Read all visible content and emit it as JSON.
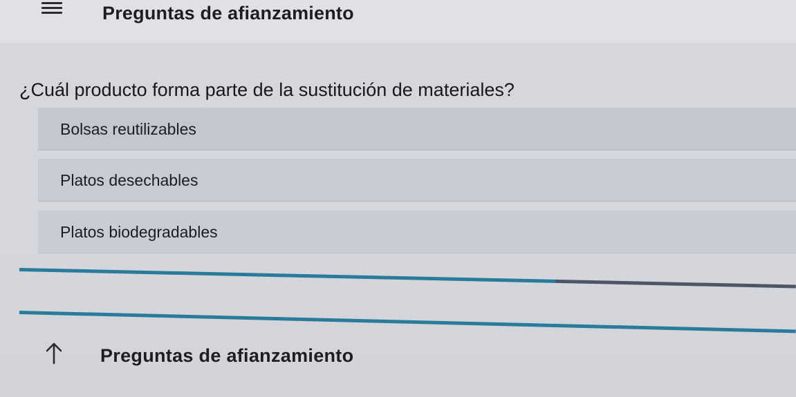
{
  "header": {
    "title": "Preguntas de afianzamiento",
    "menu_icon": "hamburger-menu-icon"
  },
  "question": {
    "text": "¿Cuál producto forma parte de la sustitución de materiales?"
  },
  "options": [
    {
      "label": "Bolsas reutilizables"
    },
    {
      "label": "Platos desechables"
    },
    {
      "label": "Platos biodegradables"
    }
  ],
  "progress": {
    "fraction": 0.69,
    "fill_color": "#2a7a9c",
    "track_color": "#4e5566"
  },
  "footer": {
    "nav_label": "Preguntas de afianzamiento",
    "nav_icon": "arrow-up-icon"
  }
}
